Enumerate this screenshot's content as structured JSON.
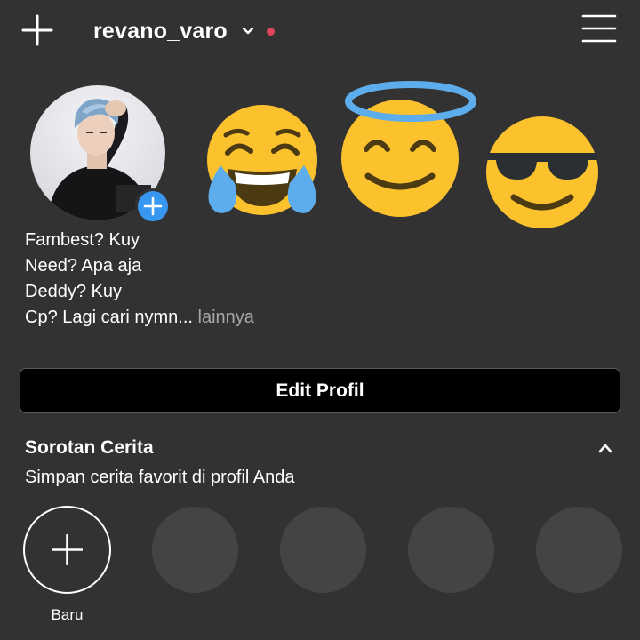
{
  "header": {
    "username": "revano_varo",
    "notification_dot_color": "#e0445a",
    "icons": [
      "plus-icon",
      "chevron-down-icon",
      "hamburger-menu-icon"
    ]
  },
  "profile": {
    "avatar_add_color": "#3897f0",
    "emojis": [
      "face-with-tears-of-joy",
      "smiling-face-with-halo",
      "smiling-face-with-sunglasses"
    ]
  },
  "bio": {
    "lines": [
      "Fambest? Kuy",
      "Need? Apa aja",
      "Deddy? Kuy",
      "Cp? Lagi cari nymn..."
    ],
    "more_label": " lainnya"
  },
  "actions": {
    "edit_profile_label": "Edit Profil"
  },
  "highlights": {
    "title": "Sorotan Cerita",
    "subtitle": "Simpan cerita favorit di profil Anda",
    "new_label": "Baru",
    "placeholder_count": 4
  },
  "colors": {
    "background": "#323232",
    "button_background": "#000000",
    "placeholder": "#444444",
    "emoji_yellow": "#fcc22d",
    "emoji_brown": "#4b3a12",
    "tear_blue": "#5dadec",
    "halo_blue": "#5dadec"
  }
}
